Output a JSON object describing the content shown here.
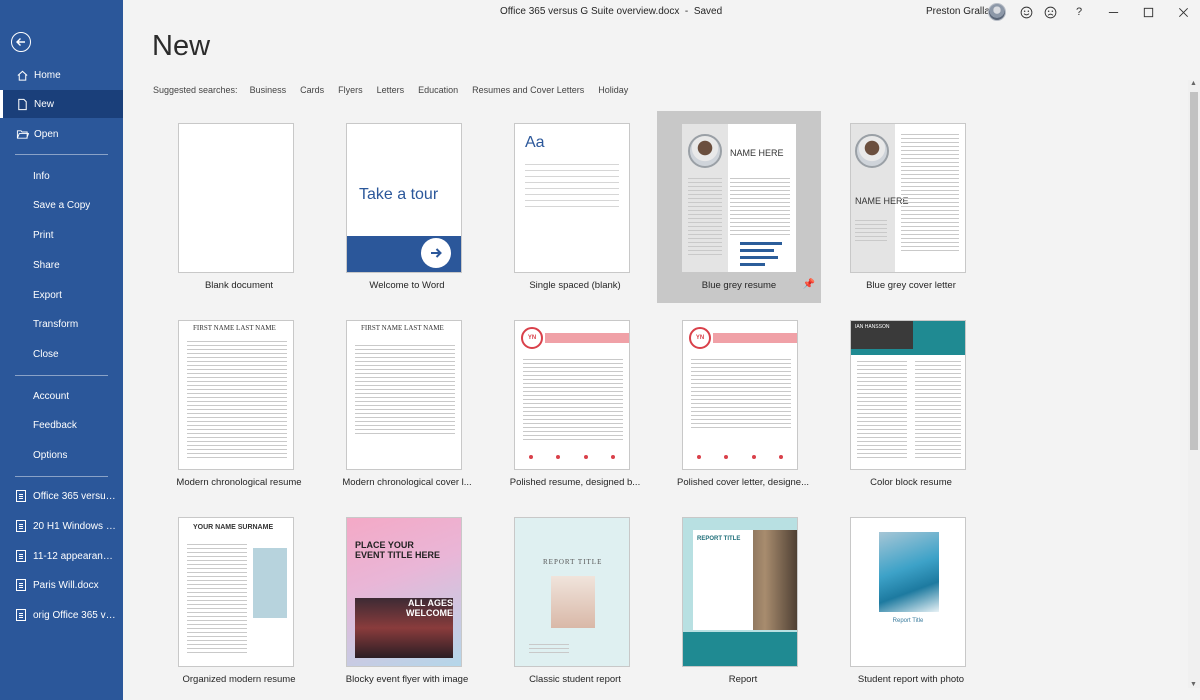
{
  "window": {
    "title": "Office 365 versus G Suite overview.docx",
    "status": "Saved",
    "user": "Preston Gralla",
    "help": "?"
  },
  "sidebar": {
    "back_label": "back",
    "items": [
      {
        "label": "Home",
        "icon": "home-icon",
        "active": false
      },
      {
        "label": "New",
        "icon": "new-doc-icon",
        "active": true
      },
      {
        "label": "Open",
        "icon": "folder-open-icon",
        "active": false
      }
    ],
    "items2": [
      {
        "label": "Info"
      },
      {
        "label": "Save a Copy"
      },
      {
        "label": "Print"
      },
      {
        "label": "Share"
      },
      {
        "label": "Export"
      },
      {
        "label": "Transform"
      },
      {
        "label": "Close"
      }
    ],
    "items3": [
      {
        "label": "Account"
      },
      {
        "label": "Feedback"
      },
      {
        "label": "Options"
      }
    ],
    "recent": [
      {
        "label": "Office 365 versus G..."
      },
      {
        "label": "20 H1 Windows 10..."
      },
      {
        "label": "11-12 appearance...."
      },
      {
        "label": "Paris Will.docx"
      },
      {
        "label": "orig Office 365 vers..."
      }
    ]
  },
  "main": {
    "title": "New",
    "suggested_label": "Suggested searches:",
    "suggested": [
      "Business",
      "Cards",
      "Flyers",
      "Letters",
      "Education",
      "Resumes and Cover Letters",
      "Holiday"
    ]
  },
  "templates": [
    {
      "label": "Blank document",
      "kind": "blank"
    },
    {
      "label": "Welcome to Word",
      "kind": "tour",
      "thumb_text": "Take a tour"
    },
    {
      "label": "Single spaced (blank)",
      "kind": "single",
      "thumb_text": "Aa"
    },
    {
      "label": "Blue grey resume",
      "kind": "bgresume",
      "selected": true,
      "thumb_text": "NAME HERE"
    },
    {
      "label": "Blue grey cover letter",
      "kind": "bgcover",
      "thumb_text": "NAME HERE"
    },
    {
      "label": "Modern chronological resume",
      "kind": "modres",
      "thumb_text": "FIRST NAME LAST NAME"
    },
    {
      "label": "Modern chronological cover l...",
      "kind": "modcover",
      "thumb_text": "FIRST NAME LAST NAME"
    },
    {
      "label": "Polished resume, designed b...",
      "kind": "polres",
      "thumb_text": "YN"
    },
    {
      "label": "Polished cover letter, designe...",
      "kind": "polcover",
      "thumb_text": "YN"
    },
    {
      "label": "Color block resume",
      "kind": "colorblock",
      "thumb_text": "IAN HANSSON"
    },
    {
      "label": "Organized modern resume",
      "kind": "orgres",
      "thumb_text": "YOUR NAME SURNAME"
    },
    {
      "label": "Blocky event flyer with image",
      "kind": "flyer",
      "thumb_text": "PLACE YOUR EVENT TITLE HERE",
      "thumb_text2": "ALL AGES WELCOME"
    },
    {
      "label": "Classic student report",
      "kind": "classic",
      "thumb_text": "REPORT TITLE"
    },
    {
      "label": "Report",
      "kind": "report",
      "thumb_text": "REPORT TITLE"
    },
    {
      "label": "Student report with photo",
      "kind": "photo",
      "thumb_text": "Report Title"
    }
  ],
  "colors": {
    "sidebar": "#2b579a",
    "accent": "#2b579a",
    "selected_tile": "#c8c8c8"
  }
}
